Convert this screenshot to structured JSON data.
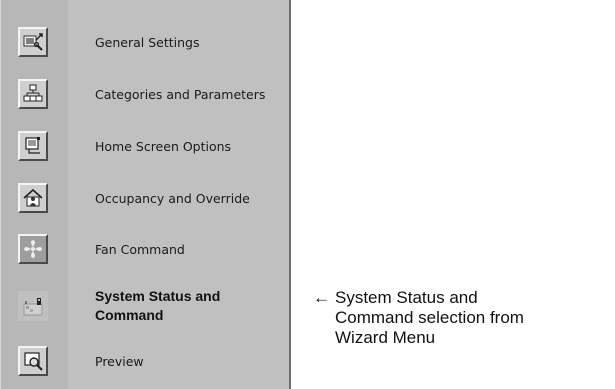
{
  "menu": {
    "items": [
      {
        "label": "General Settings",
        "icon": "settings-icon"
      },
      {
        "label": "Categories and Parameters",
        "icon": "hierarchy-icon"
      },
      {
        "label": "Home Screen Options",
        "icon": "home-screen-icon"
      },
      {
        "label": "Occupancy and Override",
        "icon": "occupancy-icon"
      },
      {
        "label": "Fan Command",
        "icon": "fan-icon"
      },
      {
        "label": "System Status and Command",
        "icon": "system-status-icon",
        "selected": true
      },
      {
        "label": "Preview",
        "icon": "preview-icon"
      }
    ]
  },
  "annotation": {
    "arrow": "←",
    "text": "System Status and\nCommand selection from\nWizard Menu"
  },
  "colors": {
    "panel_bg": "#c0c0c0",
    "icon_bg": "#cfcfcf",
    "text": "#1a1a1a"
  }
}
